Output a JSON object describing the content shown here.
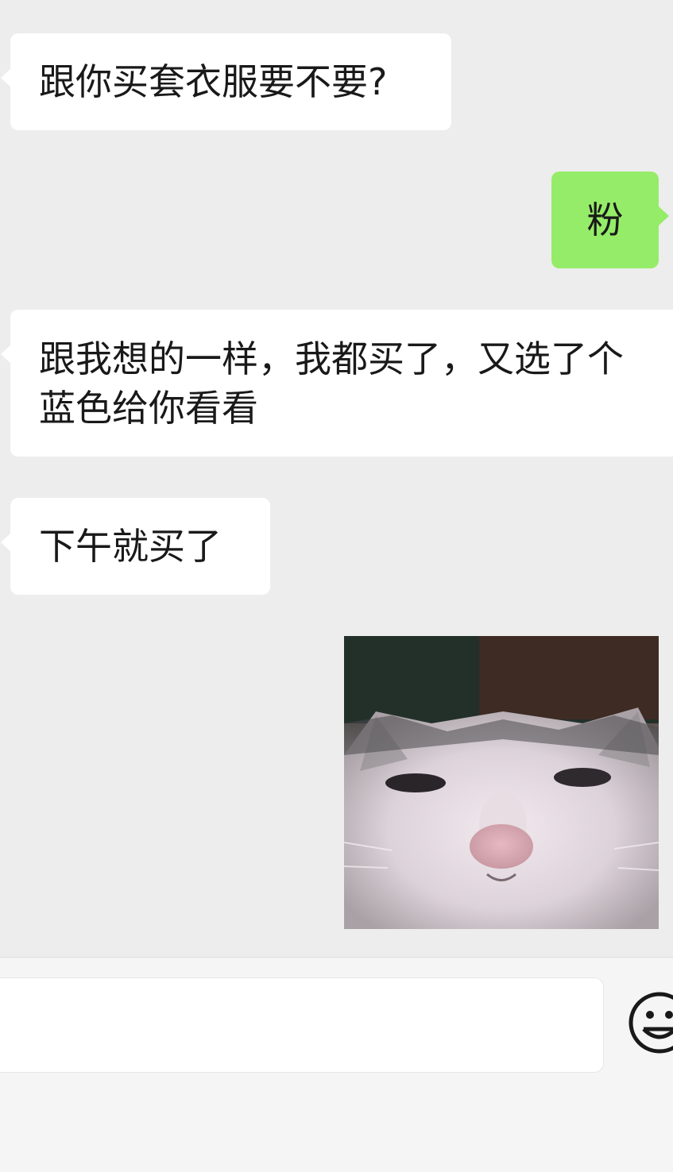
{
  "messages": [
    {
      "direction": "incoming",
      "text": "跟你买套衣服要不要?"
    },
    {
      "direction": "outgoing",
      "text": "粉"
    },
    {
      "direction": "incoming",
      "text": "跟我想的一样，我都买了，又选了个蓝色给你看看"
    },
    {
      "direction": "incoming",
      "text": "下午就买了"
    },
    {
      "direction": "outgoing",
      "type": "image",
      "icon": "cat-face-sticker"
    }
  ],
  "colors": {
    "chat_background": "#ededed",
    "incoming_bubble": "#ffffff",
    "outgoing_bubble": "#95ec69",
    "text": "#191919"
  },
  "input_bar": {
    "icon": "emoji-smile-icon"
  }
}
